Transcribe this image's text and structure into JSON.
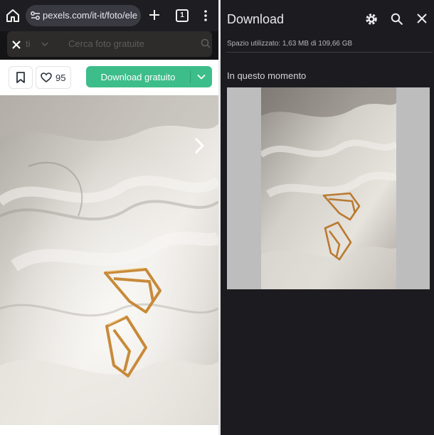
{
  "browser": {
    "url": "pexels.com/it-it/foto/ele",
    "tab_count": "1"
  },
  "site_search": {
    "category_label": "ti",
    "placeholder": "Cerca foto gratuite"
  },
  "photo_actions": {
    "like_count": "95",
    "download_label": "Download gratuito"
  },
  "download_panel": {
    "title": "Download",
    "storage_text": "Spazio utilizzato: 1,63 MB di 109,66 GB",
    "section_label": "In questo momento"
  },
  "icons": [
    "home-icon",
    "site-info-icon",
    "plus-icon",
    "tab-switcher-icon",
    "more-vert-icon",
    "close-icon",
    "chevron-down-icon",
    "search-icon",
    "bookmark-icon",
    "heart-icon",
    "chevron-right-icon",
    "settings-icon"
  ],
  "colors": {
    "download_green": "#3dbd8a",
    "panel_dark": "#1c1b20",
    "toolbar_dark": "#1e1e22"
  }
}
